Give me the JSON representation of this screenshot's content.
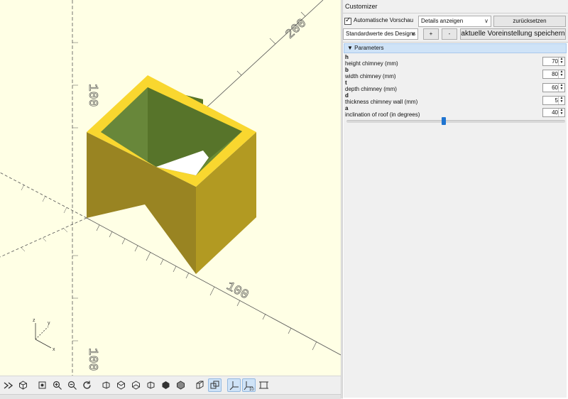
{
  "viewport": {
    "background": "#ffffe5",
    "model_color": "#f9d72f",
    "axis_labels": {
      "x": "x",
      "y": "y",
      "z": "z"
    },
    "scale_labels": [
      "200",
      "100",
      "100",
      "100"
    ]
  },
  "toolbar": {
    "buttons": [
      {
        "name": "animate-icon",
        "active": false
      },
      {
        "name": "preview-icon",
        "active": false
      },
      {
        "name": "view-all-icon",
        "active": false
      },
      {
        "name": "zoom-in-icon",
        "active": false
      },
      {
        "name": "zoom-out-icon",
        "active": false
      },
      {
        "name": "reset-view-icon",
        "active": false
      },
      {
        "name": "view-right-icon",
        "active": false
      },
      {
        "name": "view-top-icon",
        "active": false
      },
      {
        "name": "view-bottom-icon",
        "active": false
      },
      {
        "name": "view-left-icon",
        "active": false
      },
      {
        "name": "view-front-icon",
        "active": false
      },
      {
        "name": "view-back-icon",
        "active": false
      },
      {
        "name": "perspective-icon",
        "active": false
      },
      {
        "name": "orthogonal-icon",
        "active": true
      },
      {
        "name": "show-axes-icon",
        "active": true
      },
      {
        "name": "show-scale-markers-icon",
        "active": true
      },
      {
        "name": "show-edges-icon",
        "active": false
      }
    ]
  },
  "customizer": {
    "title": "Customizer",
    "auto_preview_label": "Automatische Vorschau",
    "auto_preview_checked": true,
    "details_select": "Details anzeigen",
    "reset_label": "zurücksetzen",
    "preset_select": "Standardwerte des Designs",
    "add_label": "+",
    "remove_label": "-",
    "save_preset_label": "aktuelle Voreinstellung speichern",
    "parameters_header": "Parameters",
    "params": [
      {
        "name": "h",
        "description": "height chimney (mm)",
        "value": "70"
      },
      {
        "name": "b",
        "description": "width chimney (mm)",
        "value": "80"
      },
      {
        "name": "t",
        "description": "depth chimney (mm)",
        "value": "60"
      },
      {
        "name": "d",
        "description": "thickness chimney wall (mm)",
        "value": "5"
      },
      {
        "name": "a",
        "description": "inclination of roof (in degrees)",
        "value": "40"
      }
    ],
    "slider": {
      "min": 0,
      "max": 90,
      "value": 40,
      "accent": "#1f74d0"
    }
  }
}
